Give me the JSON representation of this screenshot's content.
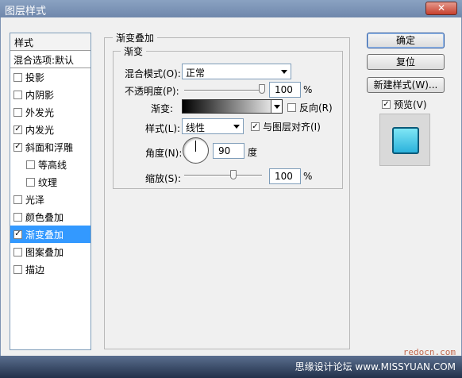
{
  "window": {
    "title": "图层样式",
    "close_symbol": "✕"
  },
  "sidebar": {
    "header": "样式",
    "blend_options": "混合选项:默认",
    "items": [
      {
        "label": "投影",
        "checked": false,
        "sub": false,
        "selected": false
      },
      {
        "label": "内阴影",
        "checked": false,
        "sub": false,
        "selected": false
      },
      {
        "label": "外发光",
        "checked": false,
        "sub": false,
        "selected": false
      },
      {
        "label": "内发光",
        "checked": true,
        "sub": false,
        "selected": false
      },
      {
        "label": "斜面和浮雕",
        "checked": true,
        "sub": false,
        "selected": false
      },
      {
        "label": "等高线",
        "checked": false,
        "sub": true,
        "selected": false
      },
      {
        "label": "纹理",
        "checked": false,
        "sub": true,
        "selected": false
      },
      {
        "label": "光泽",
        "checked": false,
        "sub": false,
        "selected": false
      },
      {
        "label": "颜色叠加",
        "checked": false,
        "sub": false,
        "selected": false
      },
      {
        "label": "渐变叠加",
        "checked": true,
        "sub": false,
        "selected": true
      },
      {
        "label": "图案叠加",
        "checked": false,
        "sub": false,
        "selected": false
      },
      {
        "label": "描边",
        "checked": false,
        "sub": false,
        "selected": false
      }
    ]
  },
  "panel": {
    "title": "渐变叠加",
    "subgroup": "渐变",
    "blend_mode_label": "混合模式(O):",
    "blend_mode_value": "正常",
    "opacity_label": "不透明度(P):",
    "opacity_value": "100",
    "opacity_unit": "%",
    "opacity_level": 1.0,
    "gradient_label": "渐变:",
    "reverse_label": "反向(R)",
    "reverse_checked": false,
    "style_label": "样式(L):",
    "style_value": "线性",
    "align_label": "与图层对齐(I)",
    "align_checked": true,
    "angle_label": "角度(N):",
    "angle_value": "90",
    "angle_unit": "度",
    "scale_label": "缩放(S):",
    "scale_value": "100",
    "scale_unit": "%"
  },
  "buttons": {
    "ok": "确定",
    "reset": "复位",
    "new_style": "新建样式(W)...",
    "preview_label": "预览(V)",
    "preview_checked": true
  },
  "watermark": {
    "url": "redocn.com",
    "text": "思缘设计论坛 www.MISSYUAN.COM"
  },
  "colors": {
    "selected": "#3399ff",
    "preview_fill": "#2bb2dc"
  }
}
